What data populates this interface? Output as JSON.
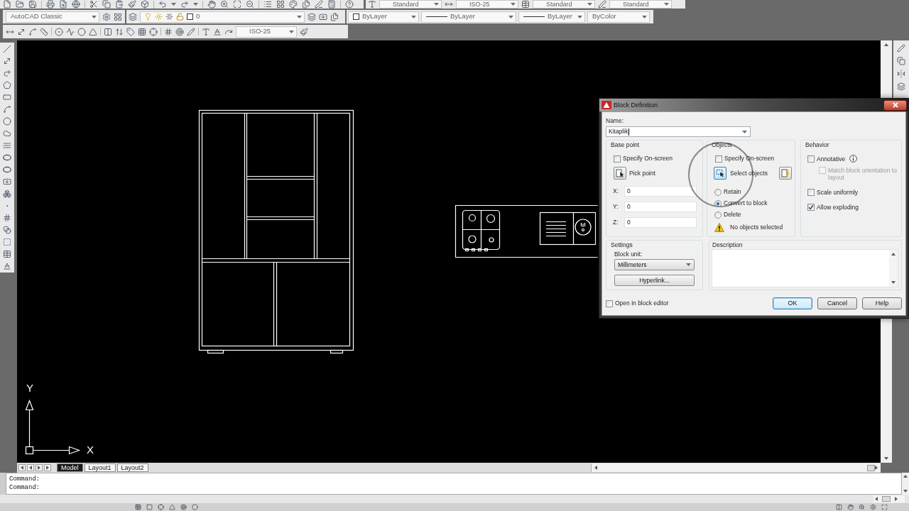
{
  "styles_toolbar": {
    "dropdowns": [
      "Standard",
      "ISO-25",
      "Standard",
      "Standard"
    ]
  },
  "workspaces_toolbar": {
    "workspace": "AutoCAD Classic"
  },
  "layers_toolbar": {
    "current_layer": "0"
  },
  "properties_toolbar": {
    "dropdowns": [
      "ByLayer",
      "ByLayer",
      "ByLayer",
      "ByColor"
    ]
  },
  "dimension_toolbar": {
    "dim_style": "ISO-25"
  },
  "ucs_icon": {
    "y_label": "Y",
    "x_label": "X"
  },
  "layout_tabs": [
    {
      "label": "Model",
      "selected": true
    },
    {
      "label": "Layout1",
      "selected": false
    },
    {
      "label": "Layout2",
      "selected": false
    }
  ],
  "command_window": {
    "lines": [
      "Command:",
      "Command:"
    ]
  },
  "dialog": {
    "title": "Block Definition",
    "name": {
      "label": "Name:",
      "value": "Kitaplik"
    },
    "base_point": {
      "title": "Base point",
      "specify_on_screen": {
        "label": "Specify On-screen",
        "checked": false
      },
      "pick_point": "Pick point",
      "coordinates": [
        {
          "label": "X:",
          "value": "0"
        },
        {
          "label": "Y:",
          "value": "0"
        },
        {
          "label": "Z:",
          "value": "0"
        }
      ]
    },
    "objects": {
      "title": "Objects",
      "specify_on_screen": {
        "label": "Specify On-screen",
        "checked": false
      },
      "select_objects": {
        "label": "Select objects",
        "highlighted": true
      },
      "options": [
        {
          "label": "Retain",
          "selected": false
        },
        {
          "label": "Convert to block",
          "selected": true
        },
        {
          "label": "Delete",
          "selected": false
        }
      ],
      "warning": "No objects selected"
    },
    "behavior": {
      "title": "Behavior",
      "options": [
        {
          "label": "Annotative",
          "checked": false,
          "disabled": false,
          "info": true,
          "children": [
            {
              "label": "Match block orientation to layout",
              "checked": false,
              "disabled": true
            }
          ]
        },
        {
          "label": "Scale uniformly",
          "checked": false,
          "disabled": false
        },
        {
          "label": "Allow exploding",
          "checked": true,
          "disabled": false
        }
      ]
    },
    "settings": {
      "title": "Settings",
      "block_unit": {
        "label": "Block unit:",
        "value": "Millimeters"
      },
      "hyperlink_button": "Hyperlink..."
    },
    "description": {
      "title": "Description"
    },
    "open_in_block_editor": {
      "label": "Open in block editor",
      "checked": false
    },
    "buttons": [
      {
        "label": "OK",
        "default": true
      },
      {
        "label": "Cancel",
        "default": false
      },
      {
        "label": "Help",
        "default": false
      }
    ]
  }
}
